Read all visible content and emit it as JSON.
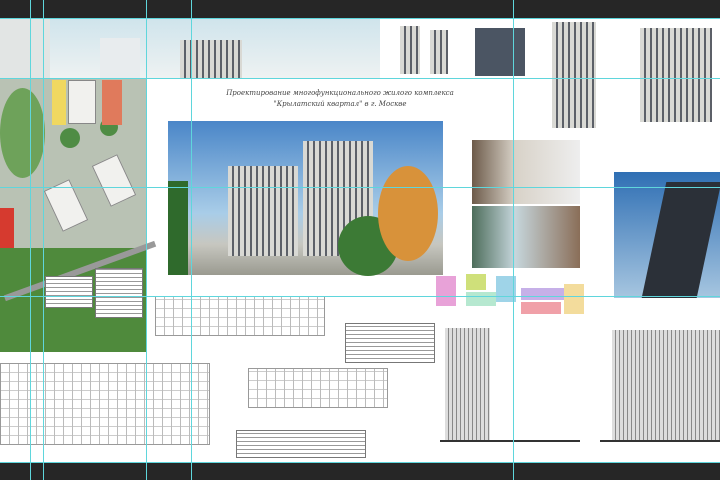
{
  "board": {
    "title_line1": "Проектирование многофункционального жилого комплекса",
    "title_line2": "\"Крылатский квартал\" в г. Москве"
  },
  "colors": {
    "guide": "#5fd6dc",
    "pasteboard": "#262626",
    "canvas": "#ffffff"
  }
}
